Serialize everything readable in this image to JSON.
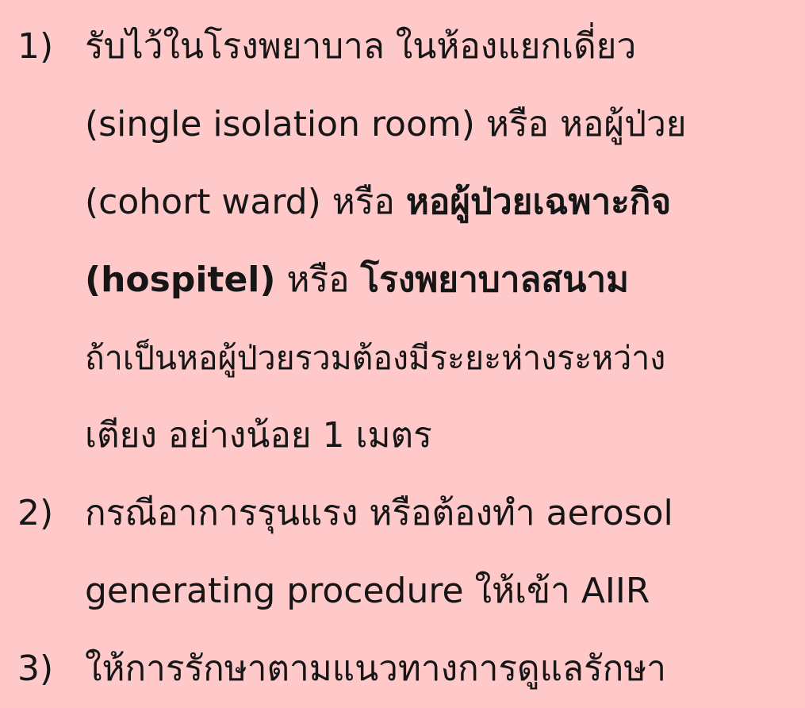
{
  "items": [
    {
      "number": "1)",
      "line1": "รับไว้ในโรงพยาบาล ในห้องแยกเดี่ยว",
      "line2": "(single isolation room) หรือ หอผู้ป่วย",
      "line3_plain": "(cohort ward) หรือ ",
      "line3_bold": "หอผู้ป่วยเฉพาะกิจ",
      "line4_bold1": "(hospitel)",
      "line4_plain": " หรือ ",
      "line4_bold2": "โรงพยาบาลสนาม",
      "line5": "ถ้าเป็นหอผู้ป่วยรวมต้องมีระยะห่างระหว่าง",
      "line6": "เตียง อย่างน้อย 1 เมตร"
    },
    {
      "number": "2)",
      "line1": "กรณีอาการรุนแรง หรือต้องทำ aerosol",
      "line2": "generating procedure ให้เข้า AIIR"
    },
    {
      "number": "3)",
      "line1": "ให้การรักษาตามแนวทางการดูแลรักษา"
    }
  ]
}
